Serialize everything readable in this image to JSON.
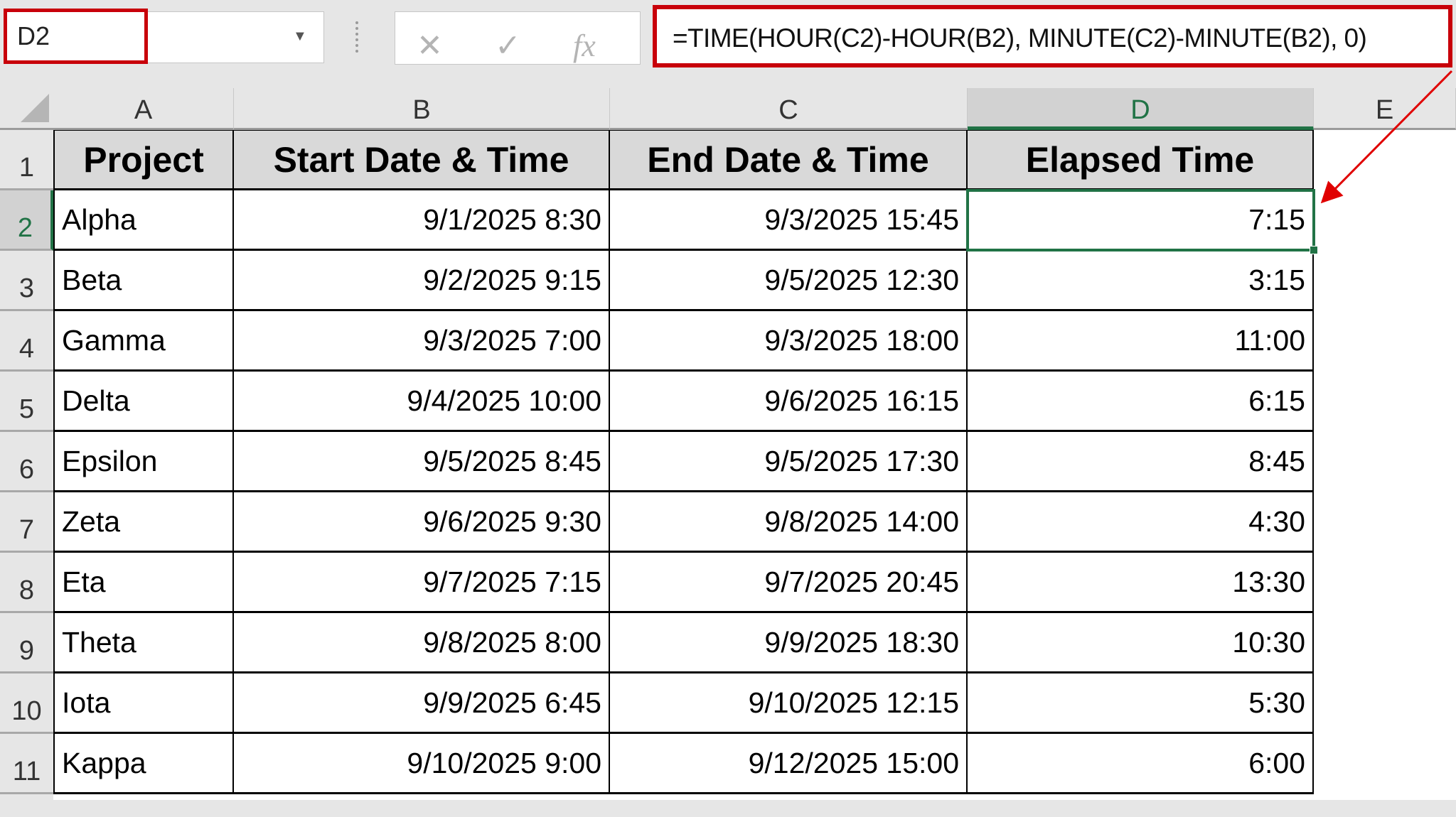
{
  "name_box": {
    "value": "D2"
  },
  "formula_bar": {
    "cancel_icon": "x-icon",
    "enter_icon": "check-icon",
    "function_icon": "fx-icon",
    "cancel": "✕",
    "enter": "✓",
    "fx": "fx",
    "formula": "=TIME(HOUR(C2)-HOUR(B2), MINUTE(C2)-MINUTE(B2), 0)"
  },
  "columns": [
    "A",
    "B",
    "C",
    "D",
    "E"
  ],
  "selected_cell": "D2",
  "highlight_color": "#c8000a",
  "rows": [
    {
      "n": "1",
      "cells": [
        "Project",
        "Start Date & Time",
        "End Date & Time",
        "Elapsed Time"
      ]
    },
    {
      "n": "2",
      "cells": [
        "Alpha",
        "9/1/2025 8:30",
        "9/3/2025 15:45",
        "7:15"
      ]
    },
    {
      "n": "3",
      "cells": [
        "Beta",
        "9/2/2025 9:15",
        "9/5/2025 12:30",
        "3:15"
      ]
    },
    {
      "n": "4",
      "cells": [
        "Gamma",
        "9/3/2025 7:00",
        "9/3/2025 18:00",
        "11:00"
      ]
    },
    {
      "n": "5",
      "cells": [
        "Delta",
        "9/4/2025 10:00",
        "9/6/2025 16:15",
        "6:15"
      ]
    },
    {
      "n": "6",
      "cells": [
        "Epsilon",
        "9/5/2025 8:45",
        "9/5/2025 17:30",
        "8:45"
      ]
    },
    {
      "n": "7",
      "cells": [
        "Zeta",
        "9/6/2025 9:30",
        "9/8/2025 14:00",
        "4:30"
      ]
    },
    {
      "n": "8",
      "cells": [
        "Eta",
        "9/7/2025 7:15",
        "9/7/2025 20:45",
        "13:30"
      ]
    },
    {
      "n": "9",
      "cells": [
        "Theta",
        "9/8/2025 8:00",
        "9/9/2025 18:30",
        "10:30"
      ]
    },
    {
      "n": "10",
      "cells": [
        "Iota",
        "9/9/2025 6:45",
        "9/10/2025 12:15",
        "5:30"
      ]
    },
    {
      "n": "11",
      "cells": [
        "Kappa",
        "9/10/2025 9:00",
        "9/12/2025 15:00",
        "6:00"
      ]
    }
  ]
}
